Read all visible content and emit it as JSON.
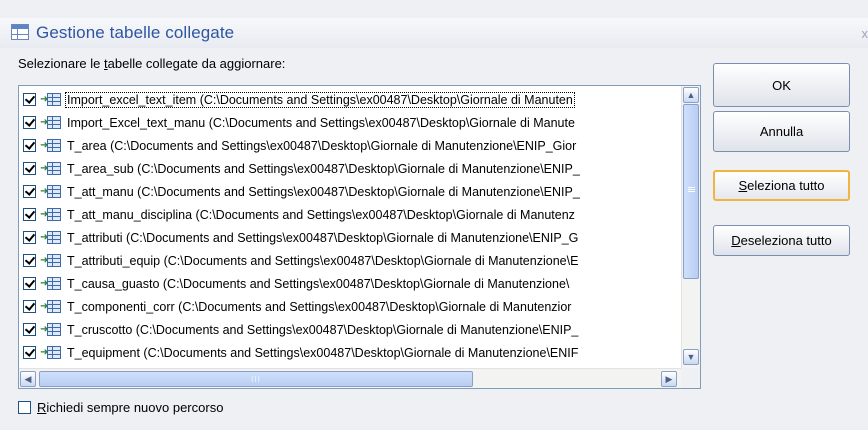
{
  "window": {
    "title": "Gestione tabelle collegate",
    "close_glyph": "x"
  },
  "prompt": {
    "before": "Selezionare le ",
    "accel": "t",
    "after": "abelle collegate da aggiornare:"
  },
  "list": {
    "items": [
      {
        "name": "Import_excel_text_item",
        "path": "(C:\\Documents and Settings\\ex00487\\Desktop\\Giornale di Manuten",
        "checked": true,
        "selected": true
      },
      {
        "name": "Import_Excel_text_manu",
        "path": "(C:\\Documents and Settings\\ex00487\\Desktop\\Giornale di Manute",
        "checked": true
      },
      {
        "name": "T_area",
        "path": "(C:\\Documents and Settings\\ex00487\\Desktop\\Giornale di Manutenzione\\ENIP_Gior",
        "checked": true
      },
      {
        "name": "T_area_sub",
        "path": "(C:\\Documents and Settings\\ex00487\\Desktop\\Giornale di Manutenzione\\ENIP_",
        "checked": true
      },
      {
        "name": "T_att_manu",
        "path": "(C:\\Documents and Settings\\ex00487\\Desktop\\Giornale di Manutenzione\\ENIP_",
        "checked": true
      },
      {
        "name": "T_att_manu_disciplina",
        "path": "(C:\\Documents and Settings\\ex00487\\Desktop\\Giornale di Manutenz",
        "checked": true
      },
      {
        "name": "T_attributi",
        "path": "(C:\\Documents and Settings\\ex00487\\Desktop\\Giornale di Manutenzione\\ENIP_G",
        "checked": true
      },
      {
        "name": "T_attributi_equip",
        "path": "(C:\\Documents and Settings\\ex00487\\Desktop\\Giornale di Manutenzione\\E",
        "checked": true
      },
      {
        "name": "T_causa_guasto",
        "path": "(C:\\Documents and Settings\\ex00487\\Desktop\\Giornale di Manutenzione\\",
        "checked": true
      },
      {
        "name": "T_componenti_corr",
        "path": "(C:\\Documents and Settings\\ex00487\\Desktop\\Giornale di Manutenzior",
        "checked": true
      },
      {
        "name": "T_cruscotto",
        "path": "(C:\\Documents and Settings\\ex00487\\Desktop\\Giornale di Manutenzione\\ENIP_",
        "checked": true
      },
      {
        "name": "T_equipment",
        "path": "(C:\\Documents and Settings\\ex00487\\Desktop\\Giornale di Manutenzione\\ENIF",
        "checked": true
      }
    ],
    "scroll_icons": {
      "up": "scroll-up-arrow",
      "down": "scroll-down-arrow",
      "left": "scroll-left-arrow",
      "right": "scroll-right-arrow"
    },
    "glyphs": {
      "up": "▲",
      "down": "▼",
      "left": "◀",
      "right": "▶",
      "grip_h": "III"
    }
  },
  "buttons": {
    "ok": {
      "label": "OK"
    },
    "cancel": {
      "label": "Annulla"
    },
    "select_all": {
      "accel": "S",
      "rest": "eleziona tutto"
    },
    "deselect_all": {
      "accel": "D",
      "rest": "eseleziona tutto"
    }
  },
  "always_ask": {
    "accel": "R",
    "rest": "ichiedi sempre nuovo percorso",
    "checked": false
  },
  "colors": {
    "title_text": "#2d55a1",
    "focus_border": "#f0b441",
    "dialog_bg": "#eef0f4"
  }
}
